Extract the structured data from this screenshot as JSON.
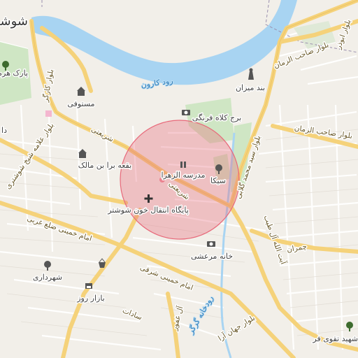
{
  "map": {
    "city_label": "شوشت",
    "river_labels": [
      "رود کارون",
      "رودخانه گرگر"
    ],
    "circle_color": "#e8697a",
    "colors": {
      "land": "#f2efe9",
      "water": "#a8d4f2",
      "park": "#cfe6c4",
      "major_road": "#f5d27a",
      "minor_road": "#ffffff"
    },
    "road_labels": [
      "بلوار صاحب الزمان",
      "بلوار صاحب الزمان",
      "بلوار ابوذر",
      "بلوار علامه شیخ شوشتری",
      "بلوار کارگر",
      "شریعتی",
      "شریعتی",
      "بلوار سید محمد گلابی",
      "امام خمینی ضلع غربی",
      "امام خمینی شرقی",
      "آیت الله آل طیب",
      "چمران",
      "بلوار جهان آرا",
      "آل غفور",
      "سادات"
    ],
    "pois": [
      {
        "icon": "park-icon",
        "label": "پارک هرمز"
      },
      {
        "icon": "landmark-icon",
        "label": "مستوفی"
      },
      {
        "icon": "landmark-icon",
        "label": "بقعه برا بن مالک"
      },
      {
        "icon": "camera-icon",
        "label": "برج کلاه فرنگی"
      },
      {
        "icon": "monument-icon",
        "label": "بند میزان"
      },
      {
        "icon": "school-icon",
        "label": "مدرسه الزهرا"
      },
      {
        "icon": "tree-icon",
        "label": "سیکا"
      },
      {
        "icon": "medical-icon",
        "label": "پایگاه انتقال خون شوشتر"
      },
      {
        "icon": "camera-icon",
        "label": "خانه مرعشی"
      },
      {
        "icon": "tree-icon",
        "label": "شهرداری"
      },
      {
        "icon": "shop-icon",
        "label": "بازار روز"
      },
      {
        "icon": "park-icon",
        "label": "شهید تقوی فر"
      },
      {
        "icon": "basket-icon",
        "label": ""
      }
    ],
    "cropped_edge_label": "دا"
  }
}
